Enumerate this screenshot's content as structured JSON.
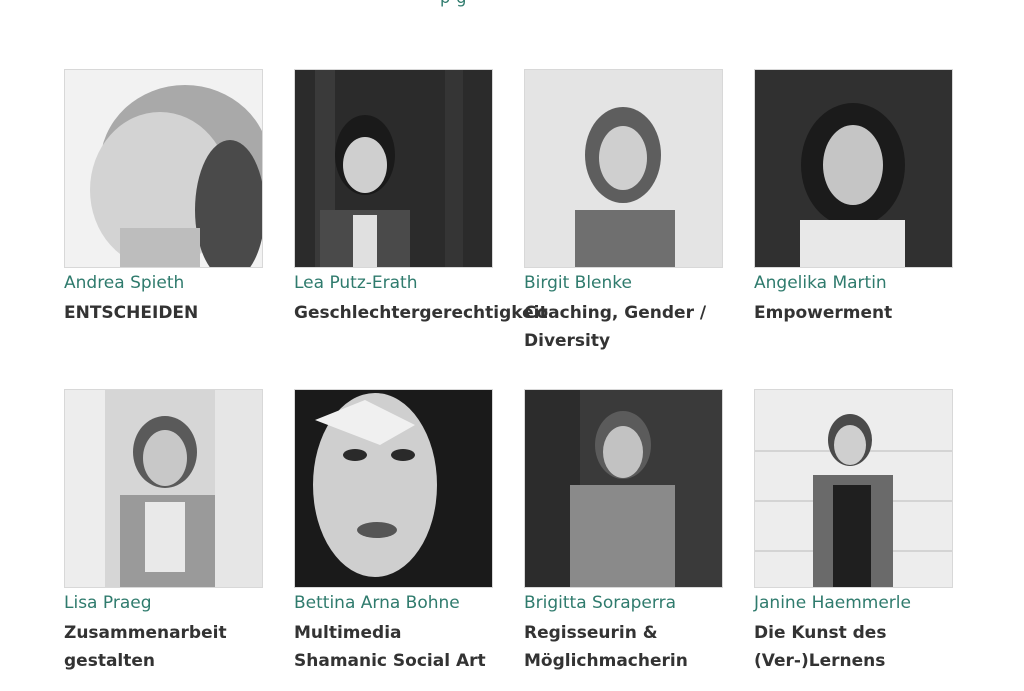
{
  "header": {
    "fragment": "p g"
  },
  "people": [
    {
      "name": "Andrea Spieth",
      "role_lines": [
        "ENTSCHEIDEN"
      ]
    },
    {
      "name": "Lea Putz-Erath",
      "role_lines": [
        "Geschlechtergerechtigkeit"
      ]
    },
    {
      "name": "Birgit Blenke",
      "role_lines": [
        "Coaching, Gender /",
        "Diversity"
      ]
    },
    {
      "name": "Angelika Martin",
      "role_lines": [
        "Empowerment"
      ]
    },
    {
      "name": "Lisa Praeg",
      "role_lines": [
        "Zusammenarbeit",
        "gestalten"
      ]
    },
    {
      "name": "Bettina Arna Bohne",
      "role_lines": [
        "Multimedia",
        "Shamanic Social Art"
      ]
    },
    {
      "name": "Brigitta Soraperra",
      "role_lines": [
        "Regisseurin &",
        "Möglichmacherin"
      ]
    },
    {
      "name": "Janine Haemmerle",
      "role_lines": [
        "Die Kunst des",
        "(Ver-)Lernens"
      ]
    }
  ],
  "colors": {
    "name_accent": "#2f7b6d",
    "role_text": "#333333"
  }
}
